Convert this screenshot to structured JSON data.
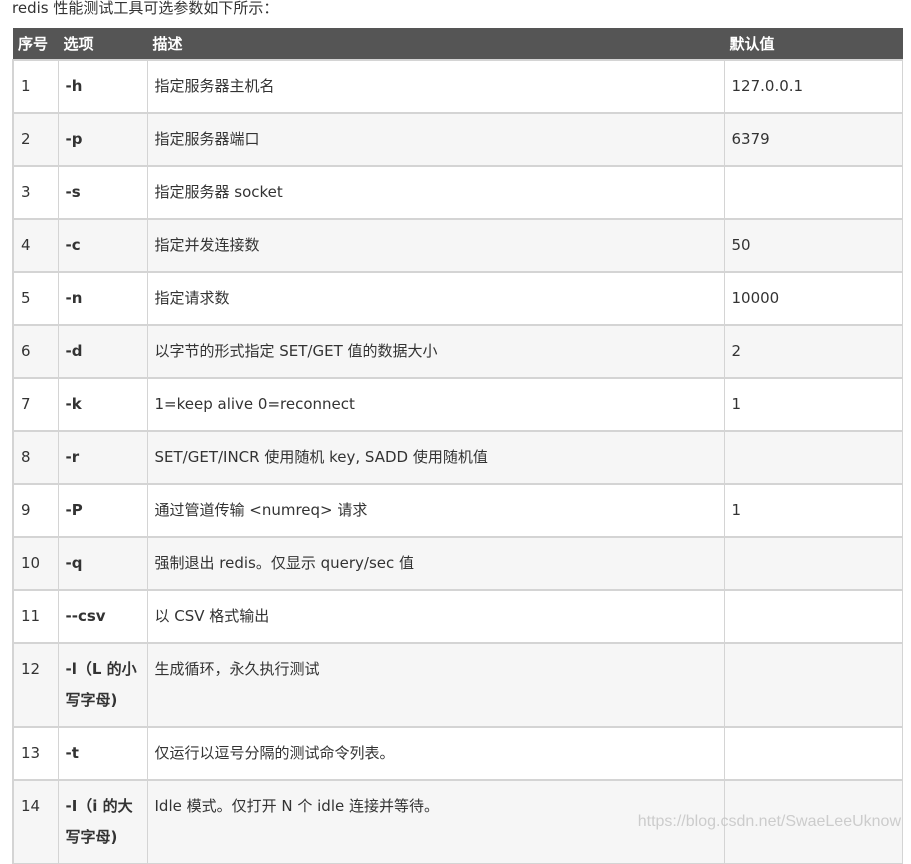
{
  "intro": "redis 性能测试工具可选参数如下所示：",
  "headers": [
    "序号",
    "选项",
    "描述",
    "默认值"
  ],
  "rows": [
    {
      "idx": "1",
      "opt": "-h",
      "desc": "指定服务器主机名",
      "def": "127.0.0.1"
    },
    {
      "idx": "2",
      "opt": "-p",
      "desc": "指定服务器端口",
      "def": "6379"
    },
    {
      "idx": "3",
      "opt": "-s",
      "desc": "指定服务器 socket",
      "def": ""
    },
    {
      "idx": "4",
      "opt": "-c",
      "desc": "指定并发连接数",
      "def": "50"
    },
    {
      "idx": "5",
      "opt": "-n",
      "desc": "指定请求数",
      "def": "10000"
    },
    {
      "idx": "6",
      "opt": "-d",
      "desc": "以字节的形式指定 SET/GET 值的数据大小",
      "def": "2"
    },
    {
      "idx": "7",
      "opt": "-k",
      "desc": "1=keep alive 0=reconnect",
      "def": "1"
    },
    {
      "idx": "8",
      "opt": "-r",
      "desc": "SET/GET/INCR 使用随机 key, SADD 使用随机值",
      "def": ""
    },
    {
      "idx": "9",
      "opt": "-P",
      "desc": "通过管道传输 <numreq> 请求",
      "def": "1"
    },
    {
      "idx": "10",
      "opt": "-q",
      "desc": "强制退出 redis。仅显示 query/sec 值",
      "def": ""
    },
    {
      "idx": "11",
      "opt": "--csv",
      "desc": "以 CSV 格式输出",
      "def": ""
    },
    {
      "idx": "12",
      "opt": "-l（L 的小写字母)",
      "desc": "生成循环，永久执行测试",
      "def": ""
    },
    {
      "idx": "13",
      "opt": "-t",
      "desc": "仅运行以逗号分隔的测试命令列表。",
      "def": ""
    },
    {
      "idx": "14",
      "opt": "-I（i 的大写字母)",
      "desc": "Idle 模式。仅打开 N 个 idle 连接并等待。",
      "def": ""
    }
  ],
  "watermark": "https://blog.csdn.net/SwaeLeeUknow"
}
